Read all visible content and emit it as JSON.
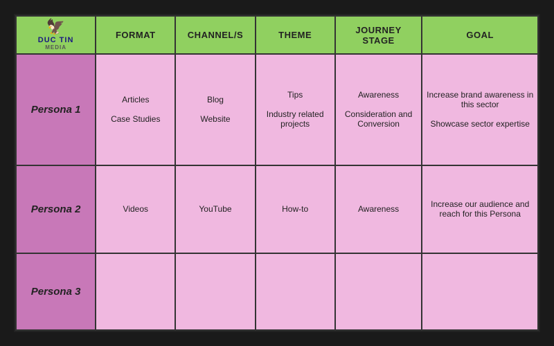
{
  "header": {
    "col_persona": "",
    "col_format": "Format",
    "col_channel": "Channel/s",
    "col_theme": "Theme",
    "col_journey": "Journey Stage",
    "col_goal": "Goal"
  },
  "logo": {
    "wings": "🦅",
    "brand_main": "DUC TIN",
    "brand_sub": "MEDIA"
  },
  "personas": [
    {
      "label": "Persona 1",
      "format": "Articles\n\nCase Studies",
      "channel": "Blog\n\nWebsite",
      "theme": "Tips\n\nIndustry related projects",
      "journey": "Awareness\n\nConsideration and Conversion",
      "goal": "Increase brand awareness in this sector\n\nShowcase sector expertise"
    },
    {
      "label": "Persona 2",
      "format": "Videos",
      "channel": "YouTube",
      "theme": "How-to",
      "journey": "Awareness",
      "goal": "Increase our audience and reach for this Persona"
    },
    {
      "label": "Persona 3",
      "format": "",
      "channel": "",
      "theme": "",
      "journey": "",
      "goal": ""
    }
  ]
}
